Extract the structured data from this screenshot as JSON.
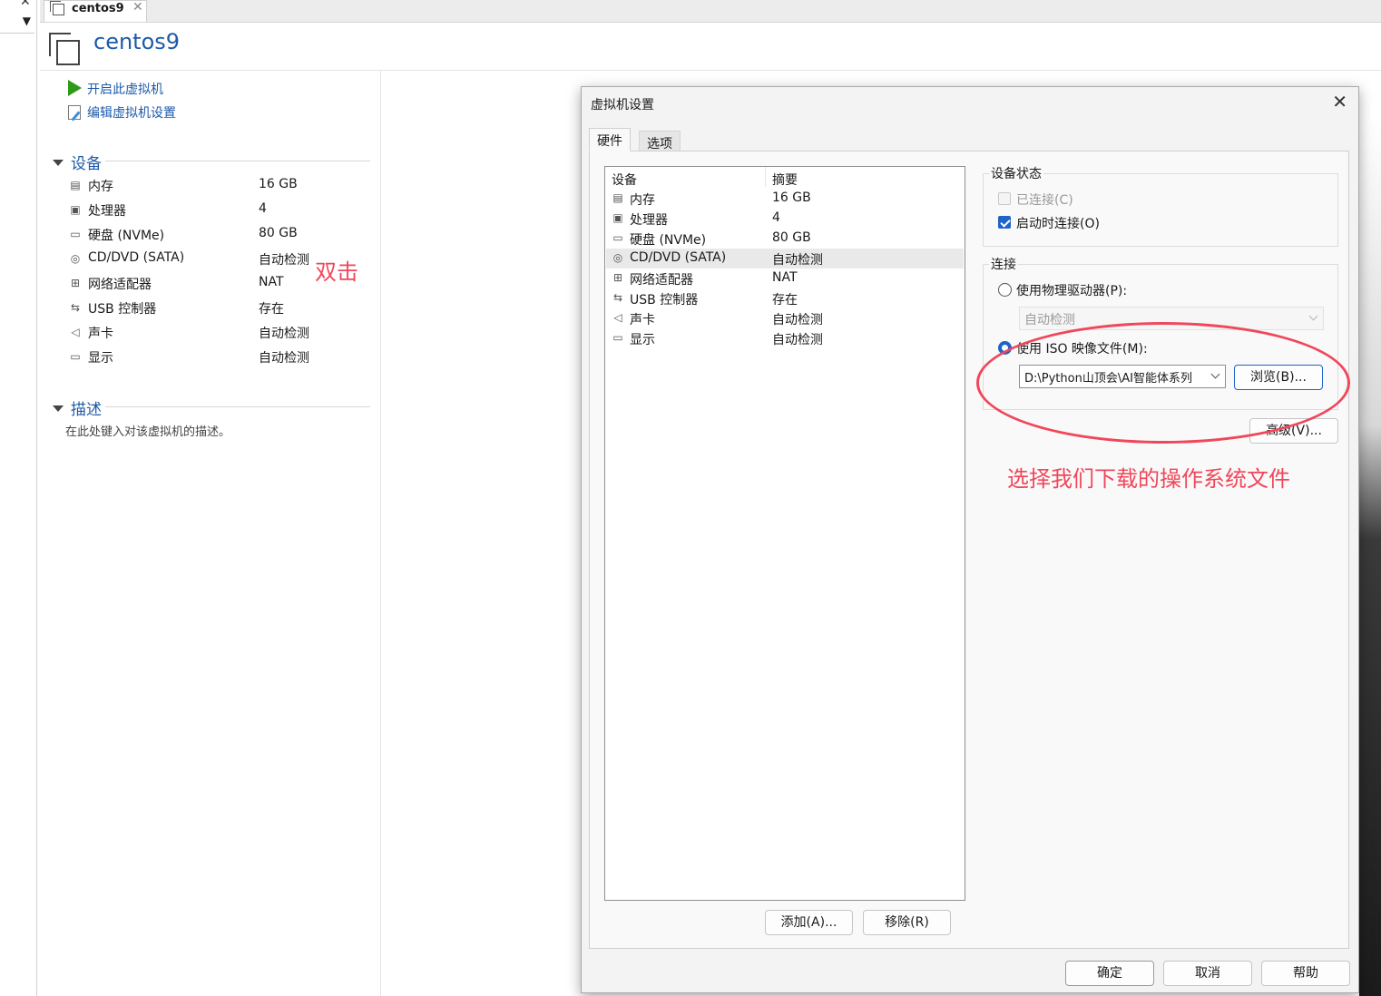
{
  "tab": {
    "label": "centos9",
    "close": "✕"
  },
  "vm": {
    "title": "centos9"
  },
  "actions": {
    "power_on": "开启此虚拟机",
    "edit_settings": "编辑虚拟机设置"
  },
  "sections": {
    "devices": "设备",
    "description": "描述"
  },
  "devices": [
    {
      "icon": "memory-icon",
      "name": "内存",
      "value": "16 GB"
    },
    {
      "icon": "processor-icon",
      "name": "处理器",
      "value": "4"
    },
    {
      "icon": "hard-disk-icon",
      "name": "硬盘 (NVMe)",
      "value": "80 GB"
    },
    {
      "icon": "cd-dvd-icon",
      "name": "CD/DVD (SATA)",
      "value": "自动检测"
    },
    {
      "icon": "network-adapter-icon",
      "name": "网络适配器",
      "value": "NAT"
    },
    {
      "icon": "usb-icon",
      "name": "USB 控制器",
      "value": "存在"
    },
    {
      "icon": "sound-card-icon",
      "name": "声卡",
      "value": "自动检测"
    },
    {
      "icon": "display-icon",
      "name": "显示",
      "value": "自动检测"
    }
  ],
  "description_placeholder": "在此处键入对该虚拟机的描述。",
  "annotations": {
    "double_click": "双击",
    "select_iso": "选择我们下载的操作系统文件"
  },
  "dialog": {
    "title": "虚拟机设置",
    "close": "✕",
    "tabs": [
      "硬件",
      "选项"
    ],
    "list_headers": {
      "device": "设备",
      "summary": "摘要"
    },
    "selected_index": 3,
    "buttons": {
      "add": "添加(A)...",
      "remove": "移除(R)",
      "ok": "确定",
      "cancel": "取消",
      "help": "帮助"
    },
    "device_status": {
      "title": "设备状态",
      "connected": {
        "label": "已连接(C)",
        "checked": false,
        "enabled": false
      },
      "connect_on_power_on": {
        "label": "启动时连接(O)",
        "checked": true
      }
    },
    "connection": {
      "title": "连接",
      "physical_drive": {
        "label": "使用物理驱动器(P):",
        "selected": false
      },
      "physical_drive_value": "自动检测",
      "iso_image": {
        "label": "使用 ISO 映像文件(M):",
        "selected": true
      },
      "iso_path": "D:\\Python山顶会\\AI智能体系列",
      "browse": "浏览(B)...",
      "advanced": "高级(V)..."
    }
  }
}
